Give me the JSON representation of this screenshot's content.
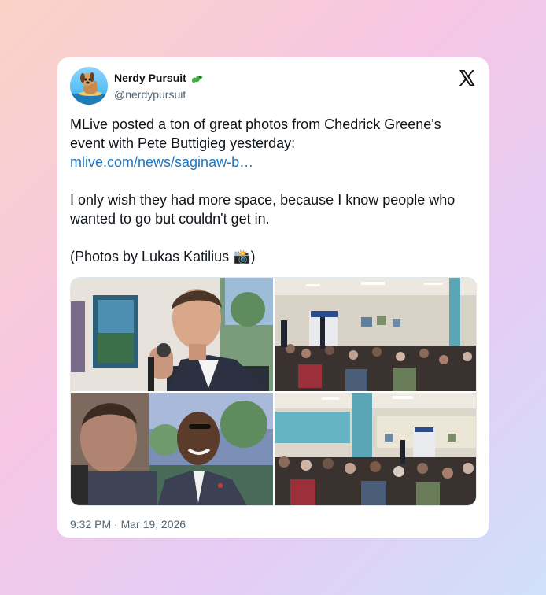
{
  "tweet": {
    "display_name": "Nerdy Pursuit",
    "handle": "@nerdypursuit",
    "badge_icon": "green-dragon-emoji",
    "platform_icon": "x-logo-icon",
    "text_line_1": "MLive posted a ton of great photos from Chedrick Greene's event with Pete Buttigieg yesterday:",
    "link_text": "mlive.com/news/saginaw-b…",
    "text_line_2": "I only wish they had more space, because I know people who wanted to go but couldn't get in.",
    "text_line_3_prefix": "(Photos by Lukas Katilius ",
    "camera_emoji": "📸",
    "text_line_3_suffix": ")",
    "timestamp": "9:32 PM · Mar 19, 2026",
    "photos": [
      {
        "subject": "man speaking into microphone"
      },
      {
        "subject": "audience in hall with stage"
      },
      {
        "subject": "smiling man in suit"
      },
      {
        "subject": "crowded room view"
      }
    ]
  },
  "colors": {
    "link": "#1d76c2",
    "text": "#0f1419",
    "secondary": "#536471"
  }
}
